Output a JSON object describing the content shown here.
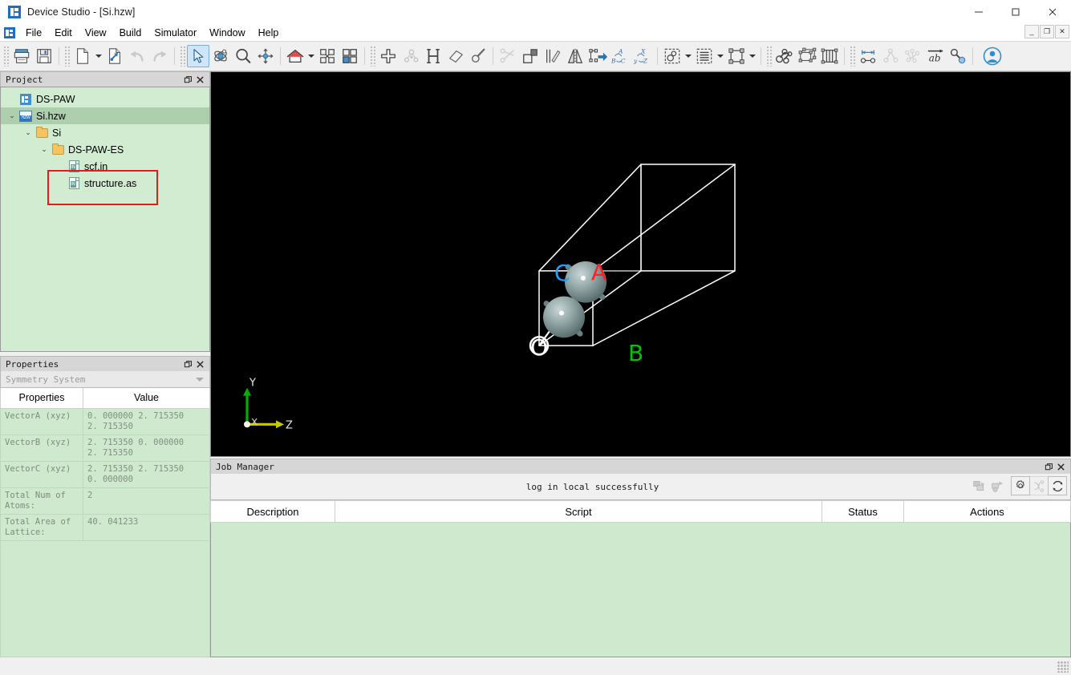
{
  "window": {
    "title": "Device Studio - [Si.hzw]",
    "app_icon": "device-studio-logo",
    "minimize": "—",
    "maximize": "□",
    "close": "✕"
  },
  "mdi": {
    "restore_down": "_",
    "restore": "❐",
    "close": "✕"
  },
  "menu": {
    "items": [
      "File",
      "Edit",
      "View",
      "Build",
      "Simulator",
      "Window",
      "Help"
    ]
  },
  "toolbar": {
    "groups": [
      {
        "buttons": [
          {
            "name": "print-icon",
            "state": "normal"
          },
          {
            "name": "save-icon",
            "state": "normal"
          }
        ]
      },
      {
        "buttons": [
          {
            "name": "new-file-icon",
            "state": "normal",
            "dropdown": true
          },
          {
            "name": "import-file-icon",
            "state": "normal"
          },
          {
            "name": "undo-icon",
            "state": "disabled"
          },
          {
            "name": "redo-icon",
            "state": "disabled"
          }
        ]
      },
      {
        "buttons": [
          {
            "name": "select-pointer-icon",
            "state": "active"
          },
          {
            "name": "rotate-icon",
            "state": "normal"
          },
          {
            "name": "zoom-icon",
            "state": "normal"
          },
          {
            "name": "pan-icon",
            "state": "normal"
          }
        ]
      },
      {
        "buttons": [
          {
            "name": "home-view-icon",
            "state": "normal",
            "dropdown": true
          },
          {
            "name": "fit-view-icon",
            "state": "normal"
          },
          {
            "name": "tile-view-icon",
            "state": "normal"
          }
        ]
      },
      {
        "buttons": [
          {
            "name": "add-atom-icon",
            "state": "normal"
          },
          {
            "name": "add-molecule-icon",
            "state": "disabled"
          },
          {
            "name": "hydrogen-icon",
            "state": "normal"
          },
          {
            "name": "eraser-icon",
            "state": "normal"
          },
          {
            "name": "pick-atom-icon",
            "state": "normal"
          }
        ]
      },
      {
        "buttons": [
          {
            "name": "cut-bond-icon",
            "state": "disabled"
          },
          {
            "name": "supercell-icon",
            "state": "normal"
          },
          {
            "name": "slab-icon",
            "state": "normal"
          },
          {
            "name": "mirror-icon",
            "state": "normal"
          },
          {
            "name": "transform-icon",
            "state": "normal"
          },
          {
            "name": "lattice-abc-icon",
            "state": "normal"
          },
          {
            "name": "axes-xyz-icon",
            "state": "normal"
          }
        ]
      },
      {
        "buttons": [
          {
            "name": "atom-style-icon",
            "state": "normal",
            "dropdown": true
          },
          {
            "name": "layer-style-icon",
            "state": "normal",
            "dropdown": true
          },
          {
            "name": "cell-style-icon",
            "state": "normal",
            "dropdown": true
          }
        ]
      },
      {
        "buttons": [
          {
            "name": "ball-stick-icon",
            "state": "normal"
          },
          {
            "name": "wireframe-icon",
            "state": "normal"
          },
          {
            "name": "polyhedra-icon",
            "state": "normal"
          }
        ]
      },
      {
        "buttons": [
          {
            "name": "measure-distance-icon",
            "state": "normal"
          },
          {
            "name": "measure-angle-icon",
            "state": "disabled"
          },
          {
            "name": "measure-torsion-icon",
            "state": "disabled"
          },
          {
            "name": "label-ab-icon",
            "state": "normal"
          },
          {
            "name": "bond-tool-icon",
            "state": "normal"
          }
        ]
      },
      {
        "buttons": [
          {
            "name": "user-account-icon",
            "state": "normal"
          }
        ]
      }
    ]
  },
  "project_panel": {
    "title": "Project",
    "float_btn": "❐",
    "close_btn": "✕",
    "tree": [
      {
        "label": "DS-PAW",
        "depth": 0,
        "icon": "project-icon",
        "chevron": "",
        "selected": false
      },
      {
        "label": "Si.hzw",
        "depth": 0,
        "icon": "hzw-file-icon",
        "chevron": "⌄",
        "selected": true
      },
      {
        "label": "Si",
        "depth": 1,
        "icon": "folder-icon",
        "chevron": "⌄",
        "selected": false
      },
      {
        "label": "DS-PAW-ES",
        "depth": 2,
        "icon": "folder-icon",
        "chevron": "⌄",
        "selected": false
      },
      {
        "label": "scf.in",
        "depth": 3,
        "icon": "in-file-icon",
        "chevron": "",
        "selected": false
      },
      {
        "label": "structure.as",
        "depth": 3,
        "icon": "in-file-icon",
        "chevron": "",
        "selected": false
      }
    ],
    "highlight_color": "#e51b1b"
  },
  "properties_panel": {
    "title": "Properties",
    "float_btn": "❐",
    "close_btn": "✕",
    "selector_value": "Symmetry System",
    "columns": [
      "Properties",
      "Value"
    ],
    "rows": [
      {
        "name": "VectorA (xyz)",
        "value": "0. 000000 2. 715350\n2. 715350"
      },
      {
        "name": "VectorB (xyz)",
        "value": "2. 715350 0. 000000\n2. 715350"
      },
      {
        "name": "VectorC (xyz)",
        "value": "2. 715350 2. 715350\n0. 000000"
      },
      {
        "name": "Total Num of\nAtoms:",
        "value": "2"
      },
      {
        "name": "Total Area of\nLattice:",
        "value": "40. 041233"
      }
    ]
  },
  "viewport": {
    "background": "#000000",
    "cell_labels": [
      {
        "text": "O",
        "color": "#ffffff"
      },
      {
        "text": "A",
        "color": "#ff1f1f"
      },
      {
        "text": "B",
        "color": "#00c400"
      },
      {
        "text": "C",
        "color": "#1f9fff"
      }
    ],
    "axis_gizmo": [
      {
        "text": "X",
        "color": "#e8e8e8"
      },
      {
        "text": "Y",
        "color": "#e8e8e8"
      },
      {
        "text": "Z",
        "color": "#e8e8e8"
      }
    ],
    "atom_count": 2,
    "atom_color": "#8ea3a3"
  },
  "job_manager": {
    "title": "Job Manager",
    "float_btn": "❐",
    "close_btn": "✕",
    "status_message": "log in local successfully",
    "toolbar_buttons": [
      {
        "name": "submit-job-icon",
        "state": "disabled"
      },
      {
        "name": "stop-job-icon",
        "state": "disabled"
      },
      {
        "name": "settings-icon",
        "state": "normal"
      },
      {
        "name": "shuffle-icon",
        "state": "disabled"
      },
      {
        "name": "refresh-icon",
        "state": "normal"
      }
    ],
    "columns": [
      "Description",
      "Script",
      "Status",
      "Actions"
    ],
    "rows": []
  }
}
